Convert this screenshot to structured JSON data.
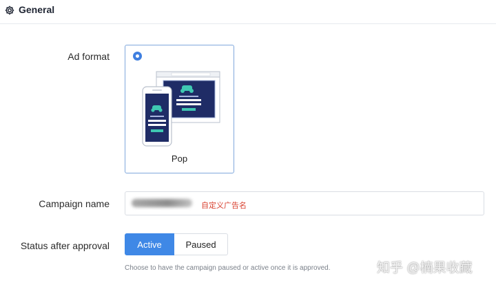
{
  "section": {
    "title": "General",
    "icon": "gear-icon"
  },
  "ad_format": {
    "label": "Ad format",
    "selected": true,
    "option_label": "Pop",
    "accent_color": "#3f7fe0"
  },
  "campaign_name": {
    "label": "Campaign name",
    "annotation": "自定义广告名",
    "annotation_color": "#d8402f"
  },
  "status": {
    "label": "Status after approval",
    "options": [
      "Active",
      "Paused"
    ],
    "selected": "Active",
    "helper": "Choose to have the campaign paused or active once it is approved."
  },
  "watermark": "知乎 @楠果收藏"
}
